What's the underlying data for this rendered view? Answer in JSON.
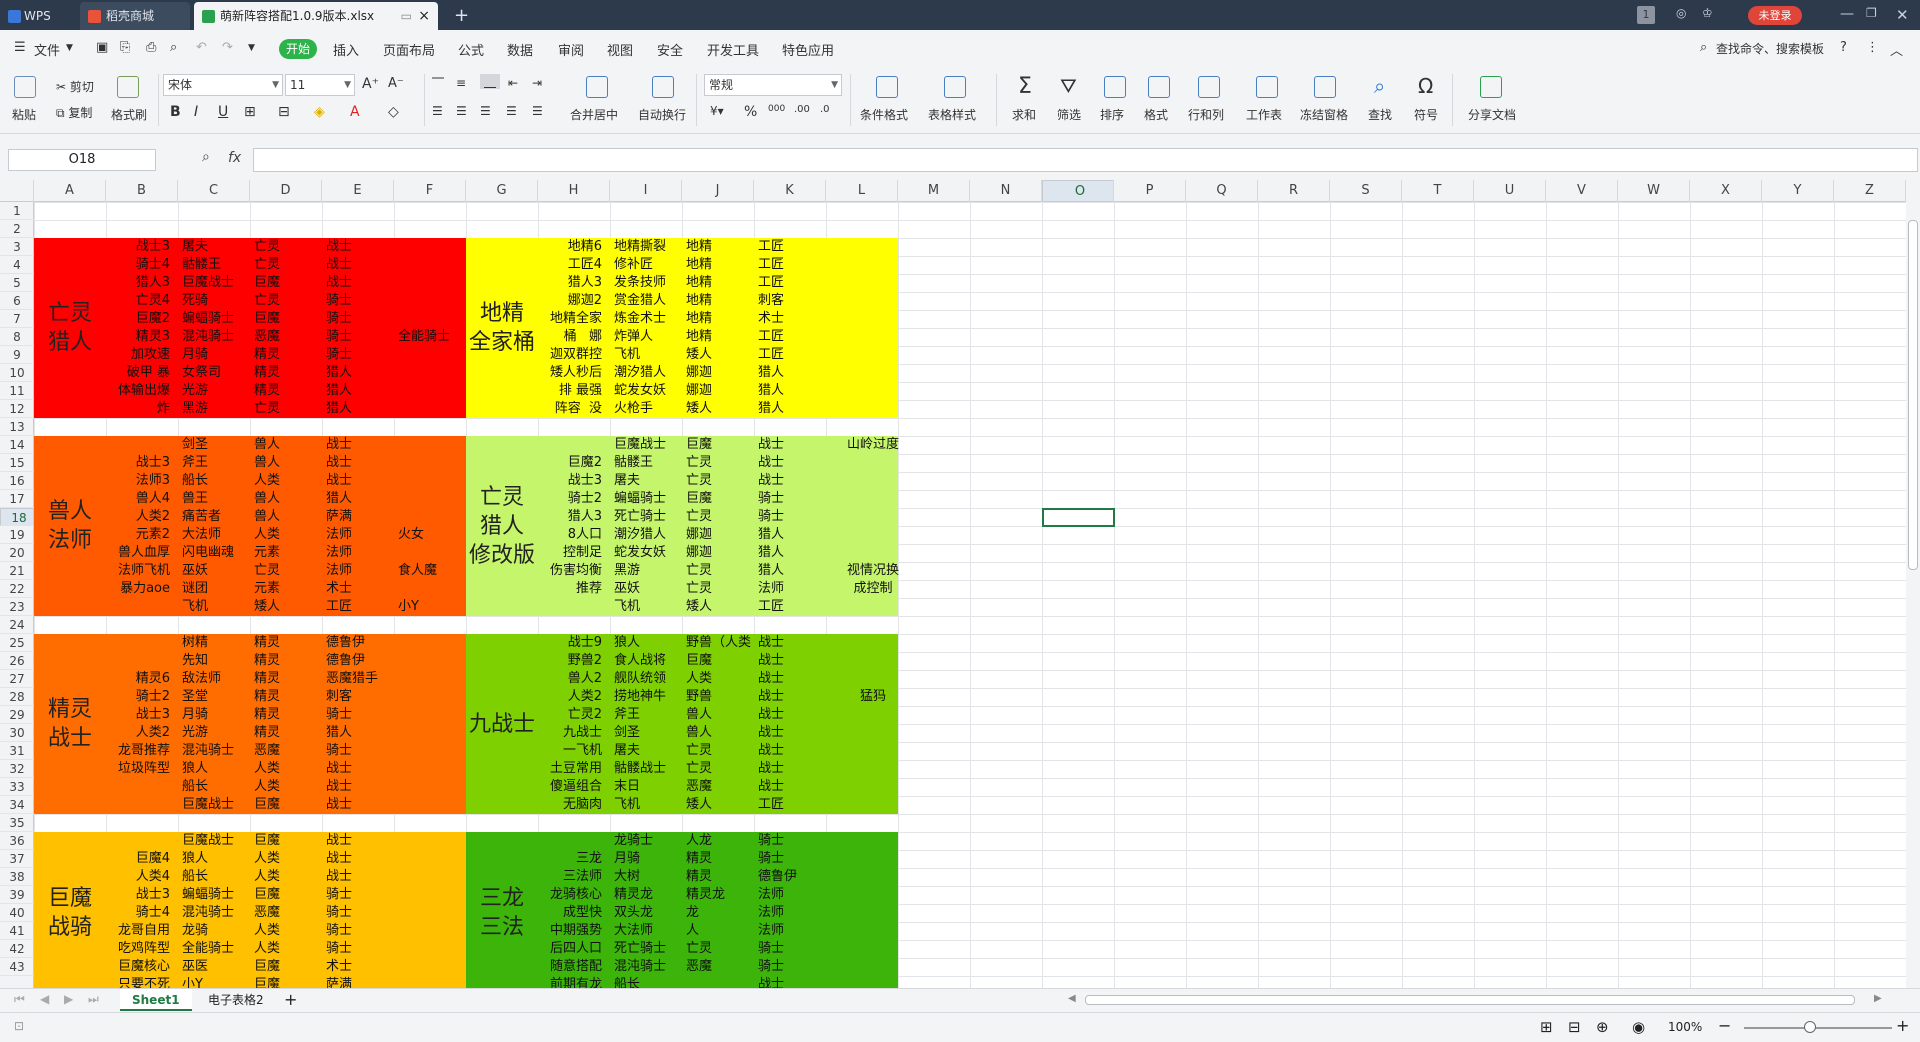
{
  "titlebar": {
    "tabs": [
      {
        "label": "WPS",
        "icon": "wps-logo-icon"
      },
      {
        "label": "稻壳商城",
        "icon": "docer-icon"
      },
      {
        "label": "萌新阵容搭配1.0.9版本.xlsx",
        "icon": "spreadsheet-icon"
      }
    ],
    "new_tab": "+",
    "page_badge": "1",
    "login": "未登录"
  },
  "menu": {
    "file": "文件",
    "items": [
      "开始",
      "插入",
      "页面布局",
      "公式",
      "数据",
      "审阅",
      "视图",
      "安全",
      "开发工具",
      "特色应用"
    ],
    "search": "查找命令、搜索模板"
  },
  "ribbon": {
    "paste": "粘贴",
    "cut": "剪切",
    "copy": "复制",
    "format_painter": "格式刷",
    "font_name": "宋体",
    "font_size": "11",
    "number_format": "常规",
    "merge": "合并居中",
    "wrap": "自动换行",
    "cond_format": "条件格式",
    "table_style": "表格样式",
    "sum": "求和",
    "filter": "筛选",
    "sort": "排序",
    "format": "格式",
    "rowcol": "行和列",
    "sheet": "工作表",
    "freeze": "冻结窗格",
    "find": "查找",
    "symbol": "符号",
    "share": "分享文档"
  },
  "formula": {
    "namebox": "O18",
    "fx": "fx",
    "value": ""
  },
  "columns": [
    "A",
    "B",
    "C",
    "D",
    "E",
    "F",
    "G",
    "H",
    "I",
    "J",
    "K",
    "L",
    "M",
    "N",
    "O",
    "P",
    "Q",
    "R",
    "S",
    "T",
    "U",
    "V",
    "W",
    "X",
    "Y",
    "Z"
  ],
  "selected_col": "O",
  "selected_row": "18",
  "rows": [
    "1",
    "2",
    "3",
    "4",
    "5",
    "6",
    "7",
    "8",
    "9",
    "10",
    "11",
    "12",
    "13",
    "14",
    "15",
    "16",
    "17",
    "18",
    "19",
    "20",
    "21",
    "22",
    "23",
    "24",
    "25",
    "26",
    "27",
    "28",
    "29",
    "30",
    "31",
    "32",
    "33",
    "34",
    "35",
    "36",
    "37",
    "38",
    "39",
    "40",
    "41",
    "42",
    "43"
  ],
  "colors": {
    "red": "#ff0000",
    "orange_red": "#ff5a00",
    "orange": "#ff6d00",
    "amber": "#ffc000",
    "yellow": "#ffff00",
    "light_green": "#c5f56a",
    "green": "#7ed000",
    "dark_green": "#3cb40a"
  },
  "blocks": {
    "undead": {
      "title": "亡灵\n猎人",
      "B": "战士3\n骑士4\n猎人3\n亡灵4\n巨魔2\n精灵3\n加攻速\n破甲 暴\n体输出爆\n炸",
      "C": "屠夫\n骷髅王\n巨魔战士\n死骑\n蝙蝠骑士\n混沌骑士\n月骑\n女祭司\n光游\n黑游",
      "D": "亡灵\n亡灵\n巨魔\n亡灵\n巨魔\n恶魔\n精灵\n精灵\n精灵\n亡灵",
      "E": "战士\n战士\n战士\n骑士\n骑士\n骑士\n骑士\n猎人\n猎人\n猎人",
      "F": "全能骑士"
    },
    "goblin": {
      "title": "地精\n全家桶",
      "H": "地精6\n工匠4\n猎人3\n娜迦2\n地精全家\n桶   娜\n迦双群控\n矮人秒后\n排 最强\n阵容  没",
      "I": "地精撕裂\n修补匠\n发条技师\n赏金猎人\n炼金术士\n炸弹人\n飞机\n潮汐猎人\n蛇发女妖\n火枪手",
      "J": "地精\n地精\n地精\n地精\n地精\n地精\n矮人\n娜迦\n娜迦\n矮人",
      "K": "工匠\n工匠\n工匠\n刺客\n术士\n工匠\n工匠\n猎人\n猎人\n猎人"
    },
    "orc": {
      "title": "兽人\n法师",
      "B": "\n战士3\n法师3\n兽人4\n人类2\n元素2\n兽人血厚\n法师飞机\n暴力aoe\n",
      "C": "剑圣\n斧王\n船长\n兽王\n痛苦者\n大法师\n闪电幽魂\n巫妖\n谜团\n飞机",
      "D": "兽人\n兽人\n人类\n兽人\n兽人\n人类\n元素\n亡灵\n元素\n矮人",
      "E": "战士\n战士\n战士\n猎人\n萨满\n法师\n法师\n法师\n术士\n工匠",
      "F": "\n\n\n\n\n火女\n\n食人魔\n\n小Y"
    },
    "undead2": {
      "title": "亡灵\n猎人\n修改版",
      "H": "\n巨魔2\n战士3\n骑士2\n猎人3\n8人口\n控制足\n伤害均衡\n推荐\n",
      "I": "巨魔战士\n骷髅王\n屠夫\n蝙蝠骑士\n死亡骑士\n潮汐猎人\n蛇发女妖\n黑游\n巫妖\n飞机",
      "J": "巨魔\n亡灵\n亡灵\n巨魔\n亡灵\n娜迦\n娜迦\n亡灵\n亡灵\n矮人",
      "K": "战士\n战士\n战士\n骑士\n骑士\n猎人\n猎人\n猎人\n法师\n工匠",
      "L_top": "山岭过度",
      "L_bottom": "视情况换\n成控制"
    },
    "elf": {
      "title": "精灵\n战士",
      "B": "\n\n精灵6\n骑士2\n战士3\n人类2\n龙哥推荐\n垃圾阵型\n\n",
      "C": "树精\n先知\n敌法师\n圣堂\n月骑\n光游\n混沌骑士\n狼人\n船长\n巨魔战士",
      "D": "精灵\n精灵\n精灵\n精灵\n精灵\n精灵\n恶魔\n人类\n人类\n巨魔",
      "E": "德鲁伊\n德鲁伊\n恶魔猎手\n刺客\n骑士\n猎人\n骑士\n战士\n战士\n战士"
    },
    "nine": {
      "title": "九战士",
      "H": "战士9\n野兽2\n兽人2\n人类2\n亡灵2\n九战士\n一飞机\n土豆常用\n傻逼组合\n无脑肉",
      "I": "狼人\n食人战将\n舰队统领\n捞地神牛\n斧王\n剑圣\n屠夫\n骷髅战士\n末日\n飞机",
      "J": "野兽（人类\n巨魔\n人类\n野兽\n兽人\n兽人\n亡灵\n亡灵\n恶魔\n矮人",
      "K": "战士\n战士\n战士\n战士\n战士\n战士\n战士\n战士\n战士\n工匠",
      "L": "猛犸"
    },
    "troll": {
      "title": "巨魔\n战骑",
      "B": "\n巨魔4\n人类4\n战士3\n骑士4\n龙哥自用\n吃鸡阵型\n巨魔核心\n只要不死\n",
      "C": "巨魔战士\n狼人\n船长\n蝙蝠骑士\n混沌骑士\n龙骑\n全能骑士\n巫医\n小Y",
      "D": "巨魔\n人类\n人类\n巨魔\n恶魔\n人类\n人类\n巨魔\n巨魔",
      "E": "战士\n战士\n战士\n骑士\n骑士\n骑士\n骑士\n术士\n萨满"
    },
    "dragon": {
      "title": "三龙\n三法",
      "H": "\n三龙\n三法师\n龙骑核心\n成型快\n中期强势\n后四人口\n随意搭配\n前期有龙",
      "I": "龙骑士\n月骑\n大树\n精灵龙\n双头龙\n大法师\n死亡骑士\n混沌骑士\n船长",
      "J": "人龙\n精灵\n精灵\n精灵龙\n龙\n人\n亡灵\n恶魔\n",
      "K": "骑士\n骑士\n德鲁伊\n法师\n法师\n法师\n骑士\n骑士\n战士"
    }
  },
  "sheets": [
    "Sheet1",
    "电子表格2"
  ],
  "status": {
    "zoom": "100%"
  }
}
